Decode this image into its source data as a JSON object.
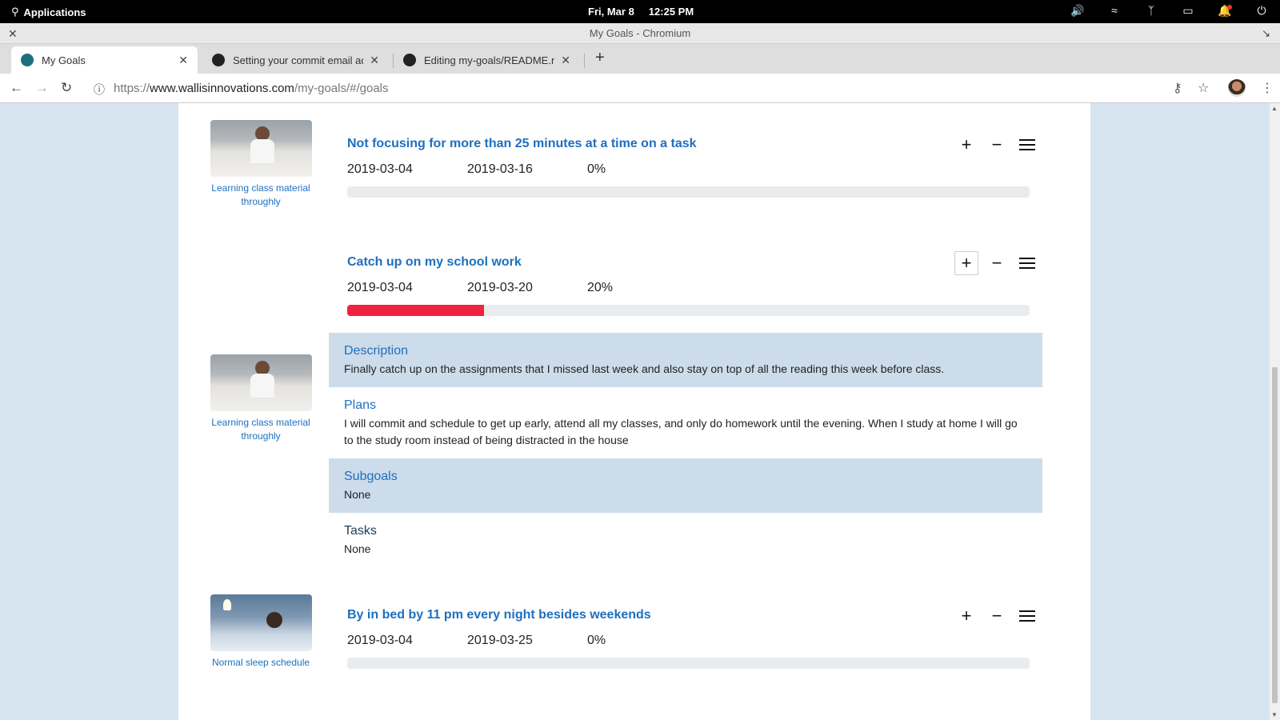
{
  "system_bar": {
    "applications": "Applications",
    "date": "Fri, Mar 8",
    "time": "12:25 PM",
    "tray_icons": [
      "volume-icon",
      "wifi-icon",
      "bluetooth-icon",
      "battery-icon",
      "notification-icon",
      "power-icon"
    ]
  },
  "window": {
    "title": "My Goals - Chromium"
  },
  "tabs": [
    {
      "label": "My Goals",
      "favicon": "react-icon",
      "active": true
    },
    {
      "label": "Setting your commit email addr",
      "favicon": "github-icon",
      "active": false
    },
    {
      "label": "Editing my-goals/README.md a",
      "favicon": "github-icon",
      "active": false
    }
  ],
  "address_bar": {
    "scheme": "https://",
    "host": "www.wallisinnovations.com",
    "path": "/my-goals/#/goals"
  },
  "goals": [
    {
      "title": "Not focusing for more than 25 minutes at a time on a task",
      "start": "2019-03-04",
      "end": "2019-03-16",
      "percent_label": "0%",
      "progress": 0,
      "image_caption": "Learning class material throughly",
      "image": "studying-photo"
    },
    {
      "title": "Catch up on my school work",
      "start": "2019-03-04",
      "end": "2019-03-20",
      "percent_label": "20%",
      "progress": 0.2,
      "image_caption": "Learning class material throughly",
      "image": "studying-photo",
      "details": {
        "description_heading": "Description",
        "description": "Finally catch up on the assignments that I missed last week and also stay on top of all the reading this week before class.",
        "plans_heading": "Plans",
        "plans": "I will commit and schedule to get up early, attend all my classes, and only do homework until the evening. When I study at home I will go to the study room instead of being distracted in the house",
        "subgoals_heading": "Subgoals",
        "subgoals": "None",
        "tasks_heading": "Tasks",
        "tasks": "None"
      }
    },
    {
      "title": "By in bed by 11 pm every night besides weekends",
      "start": "2019-03-04",
      "end": "2019-03-25",
      "percent_label": "0%",
      "progress": 0,
      "image_caption": "Normal sleep schedule",
      "image": "sleeping-photo"
    }
  ],
  "actions": {
    "add": "+",
    "remove": "−"
  },
  "colors": {
    "accent": "#1e6fbf",
    "progress_fill": "#f0233f",
    "page_bg": "#d6e4f0",
    "section_shade": "#ccdcea"
  }
}
